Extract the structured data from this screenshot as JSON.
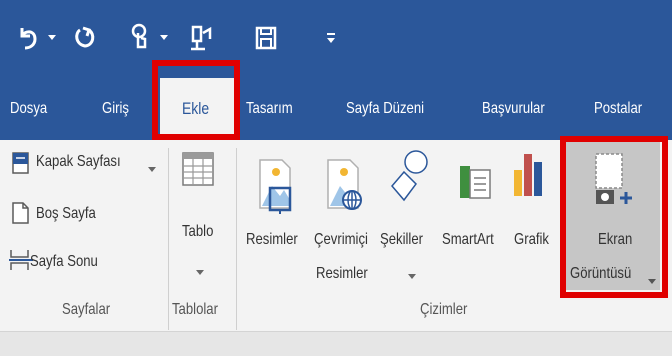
{
  "quick_access": {
    "undo_icon": "undo-icon",
    "redo_icon": "redo-icon",
    "touch_icon": "touch-mode-icon",
    "customize_icon": "customize-icon",
    "save_icon": "save-icon",
    "more_icon": "more-commands-icon"
  },
  "tabs": [
    {
      "label": "Dosya"
    },
    {
      "label": "Giriş"
    },
    {
      "label": "Ekle",
      "active": true
    },
    {
      "label": "Tasarım"
    },
    {
      "label": "Sayfa Düzeni"
    },
    {
      "label": "Başvurular"
    },
    {
      "label": "Postalar"
    }
  ],
  "groups": {
    "sayfalar": {
      "label": "Sayfalar",
      "items": [
        {
          "label": "Kapak Sayfası",
          "icon": "cover-page-icon"
        },
        {
          "label": "Boş Sayfa",
          "icon": "blank-page-icon"
        },
        {
          "label": "Sayfa Sonu",
          "icon": "page-break-icon"
        }
      ]
    },
    "tablolar": {
      "label": "Tablolar",
      "items": [
        {
          "label": "Tablo",
          "icon": "table-icon"
        }
      ]
    },
    "cizimler": {
      "label": "Çizimler",
      "items": [
        {
          "label": "Resimler",
          "icon": "pictures-icon"
        },
        {
          "label_line1": "Çevrimiçi",
          "label_line2": "Resimler",
          "icon": "online-pictures-icon"
        },
        {
          "label": "Şekiller",
          "icon": "shapes-icon"
        },
        {
          "label": "SmartArt",
          "icon": "smartart-icon"
        },
        {
          "label": "Grafik",
          "icon": "chart-icon"
        },
        {
          "label_line1": "Ekran",
          "label_line2": "Görüntüsü",
          "icon": "screenshot-icon"
        }
      ]
    }
  },
  "colors": {
    "accent": "#2b579a",
    "highlight": "#e00000"
  }
}
